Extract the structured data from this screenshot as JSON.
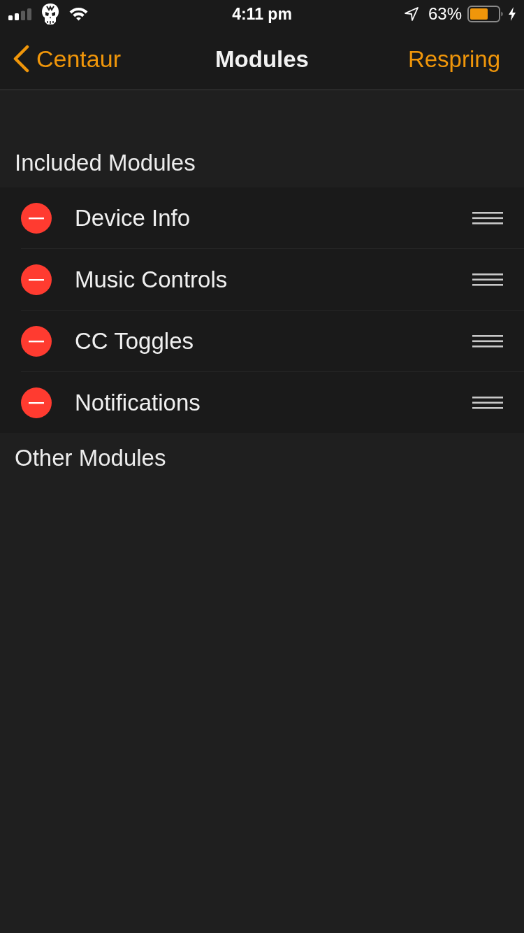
{
  "status_bar": {
    "time": "4:11 pm",
    "battery": "63%"
  },
  "nav": {
    "back": "Centaur",
    "title": "Modules",
    "action": "Respring"
  },
  "sections": [
    {
      "header": "Included Modules",
      "rows": [
        {
          "label": "Device Info"
        },
        {
          "label": "Music Controls"
        },
        {
          "label": "CC Toggles"
        },
        {
          "label": "Notifications"
        }
      ]
    },
    {
      "header": "Other Modules"
    }
  ]
}
